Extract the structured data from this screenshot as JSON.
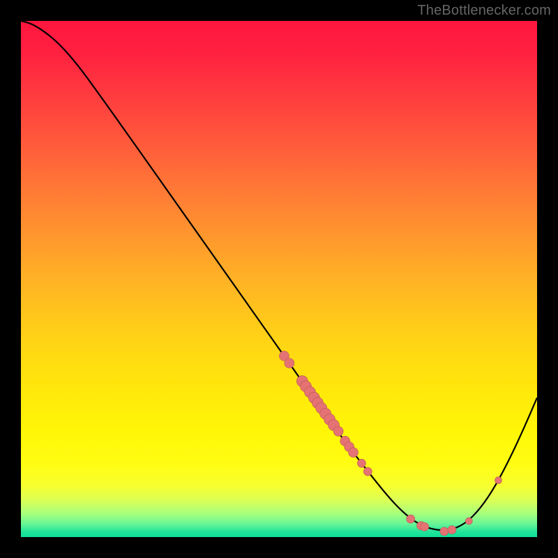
{
  "watermark": "TheBottlenecker.com",
  "colors": {
    "gradient_stops": [
      {
        "offset": 0.0,
        "color": "#ff163e"
      },
      {
        "offset": 0.06,
        "color": "#ff2040"
      },
      {
        "offset": 0.14,
        "color": "#ff3a3f"
      },
      {
        "offset": 0.24,
        "color": "#ff5b3b"
      },
      {
        "offset": 0.36,
        "color": "#ff8433"
      },
      {
        "offset": 0.5,
        "color": "#ffb225"
      },
      {
        "offset": 0.62,
        "color": "#ffd415"
      },
      {
        "offset": 0.72,
        "color": "#ffe90a"
      },
      {
        "offset": 0.8,
        "color": "#fff707"
      },
      {
        "offset": 0.86,
        "color": "#fffd14"
      },
      {
        "offset": 0.9,
        "color": "#f8ff2e"
      },
      {
        "offset": 0.93,
        "color": "#d9ff58"
      },
      {
        "offset": 0.955,
        "color": "#a6ff7d"
      },
      {
        "offset": 0.975,
        "color": "#66f596"
      },
      {
        "offset": 0.99,
        "color": "#20e59a"
      },
      {
        "offset": 1.0,
        "color": "#0fdf98"
      }
    ],
    "curve": "#000000",
    "marker_fill": "#e57373",
    "marker_stroke": "#b85555",
    "frame_bg": "#000000"
  },
  "chart_data": {
    "type": "line",
    "title": "",
    "xlabel": "",
    "ylabel": "",
    "xlim": [
      0,
      1
    ],
    "ylim": [
      0,
      1
    ],
    "curve": [
      {
        "x": 0.0,
        "y": 1.0
      },
      {
        "x": 0.02,
        "y": 0.995
      },
      {
        "x": 0.045,
        "y": 0.98
      },
      {
        "x": 0.075,
        "y": 0.955
      },
      {
        "x": 0.11,
        "y": 0.915
      },
      {
        "x": 0.15,
        "y": 0.86
      },
      {
        "x": 0.2,
        "y": 0.79
      },
      {
        "x": 0.26,
        "y": 0.705
      },
      {
        "x": 0.32,
        "y": 0.62
      },
      {
        "x": 0.38,
        "y": 0.535
      },
      {
        "x": 0.44,
        "y": 0.45
      },
      {
        "x": 0.5,
        "y": 0.365
      },
      {
        "x": 0.56,
        "y": 0.28
      },
      {
        "x": 0.62,
        "y": 0.195
      },
      {
        "x": 0.67,
        "y": 0.13
      },
      {
        "x": 0.71,
        "y": 0.08
      },
      {
        "x": 0.74,
        "y": 0.048
      },
      {
        "x": 0.77,
        "y": 0.025
      },
      {
        "x": 0.8,
        "y": 0.014
      },
      {
        "x": 0.83,
        "y": 0.013
      },
      {
        "x": 0.86,
        "y": 0.025
      },
      {
        "x": 0.89,
        "y": 0.055
      },
      {
        "x": 0.92,
        "y": 0.1
      },
      {
        "x": 0.95,
        "y": 0.158
      },
      {
        "x": 0.975,
        "y": 0.212
      },
      {
        "x": 1.0,
        "y": 0.27
      }
    ],
    "markers": [
      {
        "x": 0.51,
        "y": 0.351,
        "r": 7
      },
      {
        "x": 0.52,
        "y": 0.337,
        "r": 7
      },
      {
        "x": 0.545,
        "y": 0.302,
        "r": 8
      },
      {
        "x": 0.552,
        "y": 0.292,
        "r": 8
      },
      {
        "x": 0.56,
        "y": 0.281,
        "r": 8
      },
      {
        "x": 0.568,
        "y": 0.27,
        "r": 8
      },
      {
        "x": 0.575,
        "y": 0.26,
        "r": 8
      },
      {
        "x": 0.582,
        "y": 0.25,
        "r": 8
      },
      {
        "x": 0.59,
        "y": 0.239,
        "r": 8
      },
      {
        "x": 0.598,
        "y": 0.228,
        "r": 8
      },
      {
        "x": 0.606,
        "y": 0.217,
        "r": 8
      },
      {
        "x": 0.615,
        "y": 0.205,
        "r": 7
      },
      {
        "x": 0.628,
        "y": 0.186,
        "r": 7
      },
      {
        "x": 0.636,
        "y": 0.175,
        "r": 7
      },
      {
        "x": 0.644,
        "y": 0.164,
        "r": 7
      },
      {
        "x": 0.66,
        "y": 0.143,
        "r": 6
      },
      {
        "x": 0.672,
        "y": 0.127,
        "r": 6
      },
      {
        "x": 0.755,
        "y": 0.035,
        "r": 6
      },
      {
        "x": 0.775,
        "y": 0.022,
        "r": 6
      },
      {
        "x": 0.782,
        "y": 0.02,
        "r": 6
      },
      {
        "x": 0.82,
        "y": 0.011,
        "r": 6
      },
      {
        "x": 0.835,
        "y": 0.014,
        "r": 6
      },
      {
        "x": 0.868,
        "y": 0.031,
        "r": 5
      },
      {
        "x": 0.925,
        "y": 0.11,
        "r": 5
      }
    ]
  }
}
